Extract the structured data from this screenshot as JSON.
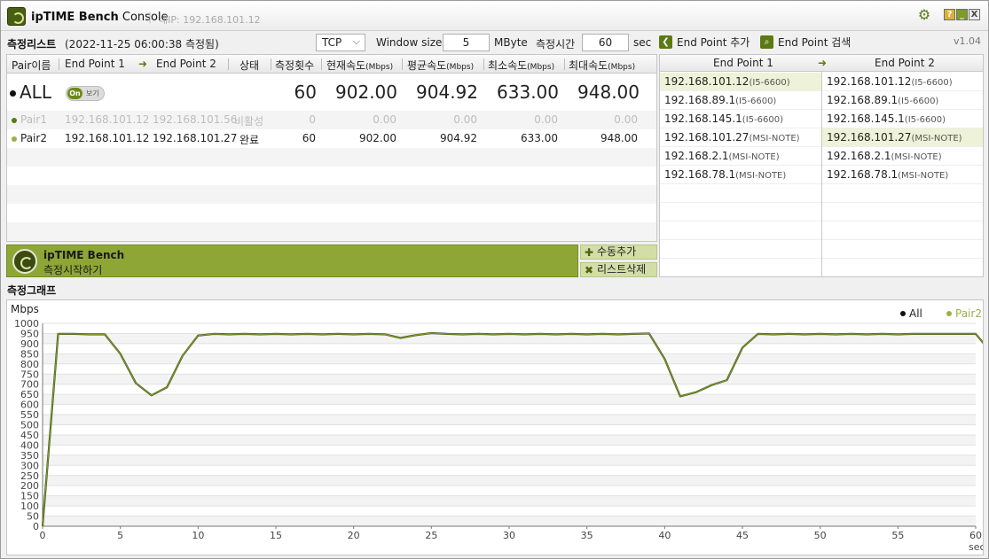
{
  "title_bar": {
    "app_name_bold": "ipTIME Bench",
    "app_name_rest": " Console",
    "separator": "|",
    "internal_ip": "내IP: 192.168.101.12",
    "help_label": "?",
    "min_label": "_",
    "close_label": "X"
  },
  "toolbar": {
    "list_title": "측정리스트",
    "measured_at": "(2022-11-25 06:00:38 측정됨)",
    "protocol": "TCP",
    "window_size_label": "Window size",
    "window_size_value": "5",
    "window_size_unit": "MByte",
    "duration_label": "측정시간",
    "duration_value": "60",
    "duration_unit": "sec",
    "add_endpoint": "End Point 추가",
    "search_endpoint": "End Point 검색",
    "version": "v1.04"
  },
  "table": {
    "headers": {
      "pair": "Pair이름",
      "ep1": "End Point 1",
      "ep2": "End Point 2",
      "status": "상태",
      "count": "측정횟수",
      "current": "현재속도",
      "avg": "평균속도",
      "min": "최소속도",
      "max": "최대속도",
      "unit": "(Mbps)"
    },
    "all_row": {
      "name": "ALL",
      "toggle_on": "On",
      "toggle_label": "보기",
      "count": "60",
      "current": "902.00",
      "avg": "904.92",
      "min": "633.00",
      "max": "948.00"
    },
    "rows": [
      {
        "name": "Pair1",
        "ep1": "192.168.101.12",
        "ep2": "192.168.101.56",
        "status": "비활성",
        "count": "0",
        "current": "0.00",
        "avg": "0.00",
        "min": "0.00",
        "max": "0.00",
        "dot_color": "#5c7a14"
      },
      {
        "name": "Pair2",
        "ep1": "192.168.101.12",
        "ep2": "192.168.101.27",
        "status": "완료",
        "count": "60",
        "current": "902.00",
        "avg": "904.92",
        "min": "633.00",
        "max": "948.00",
        "dot_color": "#9bb04a"
      }
    ]
  },
  "bench": {
    "title": "ipTIME Bench",
    "subtitle": "측정시작하기",
    "add_manual": "수동추가",
    "delete_list": "리스트삭제"
  },
  "endpoints": {
    "header1": "End Point 1",
    "header2": "End Point 2",
    "ep1": [
      {
        "ip": "192.168.101.12",
        "host": "(I5-6600)"
      },
      {
        "ip": "192.168.89.1",
        "host": "(I5-6600)"
      },
      {
        "ip": "192.168.145.1",
        "host": "(I5-6600)"
      },
      {
        "ip": "192.168.101.27",
        "host": "(MSI-NOTE)"
      },
      {
        "ip": "192.168.2.1",
        "host": "(MSI-NOTE)"
      },
      {
        "ip": "192.168.78.1",
        "host": "(MSI-NOTE)"
      }
    ],
    "ep2": [
      {
        "ip": "192.168.101.12",
        "host": "(I5-6600)"
      },
      {
        "ip": "192.168.89.1",
        "host": "(I5-6600)"
      },
      {
        "ip": "192.168.145.1",
        "host": "(I5-6600)"
      },
      {
        "ip": "192.168.101.27",
        "host": "(MSI-NOTE)"
      },
      {
        "ip": "192.168.2.1",
        "host": "(MSI-NOTE)"
      },
      {
        "ip": "192.168.78.1",
        "host": "(MSI-NOTE)"
      }
    ],
    "selected_ep1_index": 0,
    "selected_ep2_index": 3
  },
  "graph_section": {
    "title": "측정그래프"
  },
  "chart_data": {
    "type": "line",
    "ylabel": "Mbps",
    "xlabel": "sec",
    "ylim": [
      0,
      1000
    ],
    "xlim": [
      0,
      60
    ],
    "y_ticks": [
      0,
      50,
      100,
      150,
      200,
      250,
      300,
      350,
      400,
      450,
      500,
      550,
      600,
      650,
      700,
      750,
      800,
      850,
      900,
      950,
      1000
    ],
    "x_ticks": [
      0,
      5,
      10,
      15,
      20,
      25,
      30,
      35,
      40,
      45,
      50,
      55,
      60
    ],
    "legend": [
      {
        "name": "All",
        "color": "#111111"
      },
      {
        "name": "Pair2",
        "color": "#9bb04a"
      }
    ],
    "legend_position": "top-right",
    "series": [
      {
        "name": "Pair2",
        "color": "#7d9a2a",
        "x": [
          0,
          1,
          2,
          3,
          4,
          5,
          6,
          7,
          8,
          9,
          10,
          11,
          12,
          13,
          14,
          15,
          16,
          17,
          18,
          19,
          20,
          21,
          22,
          23,
          24,
          25,
          26,
          27,
          28,
          29,
          30,
          31,
          32,
          33,
          34,
          35,
          36,
          37,
          38,
          39,
          40,
          41,
          42,
          43,
          44,
          45,
          46,
          47,
          48,
          49,
          50,
          51,
          52,
          53,
          54,
          55,
          56,
          57,
          58,
          59,
          60,
          60.5
        ],
        "values": [
          0,
          948,
          948,
          946,
          946,
          850,
          705,
          645,
          685,
          840,
          940,
          948,
          946,
          948,
          946,
          948,
          946,
          948,
          946,
          948,
          946,
          948,
          946,
          928,
          942,
          952,
          948,
          946,
          948,
          946,
          948,
          946,
          948,
          946,
          948,
          946,
          948,
          946,
          948,
          950,
          825,
          640,
          660,
          695,
          720,
          880,
          948,
          946,
          948,
          946,
          948,
          946,
          948,
          946,
          948,
          946,
          948,
          948,
          948,
          948,
          948,
          902
        ]
      }
    ]
  }
}
